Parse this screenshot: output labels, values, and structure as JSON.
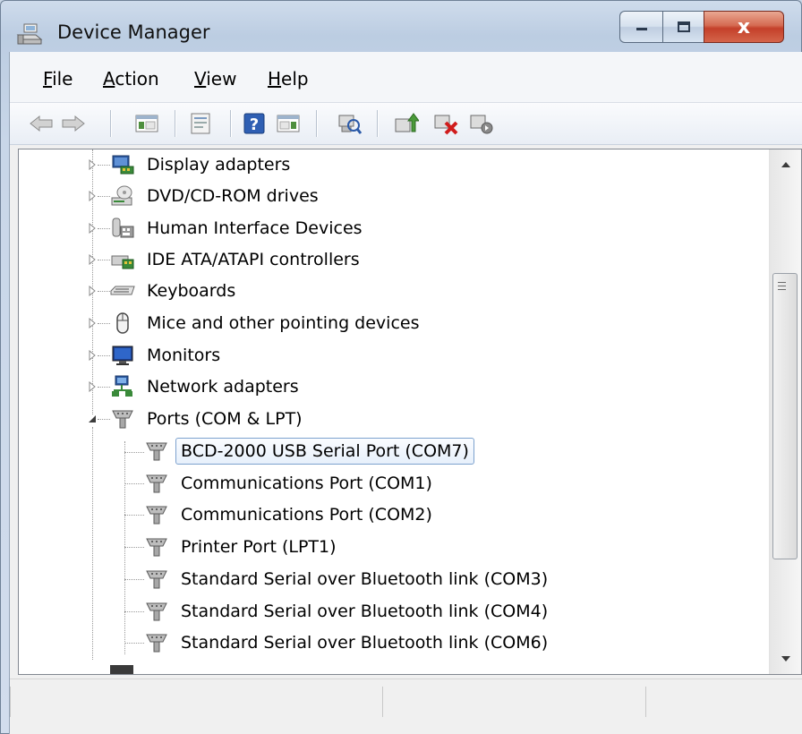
{
  "window": {
    "title": "Device Manager",
    "title_icon": "device-manager-icon",
    "caption": {
      "minimize": "minimize-icon",
      "maximize": "maximize-icon",
      "close_glyph": "x"
    }
  },
  "menu": {
    "items": [
      {
        "label_first": "F",
        "label_rest": "ile"
      },
      {
        "label_first": "A",
        "label_rest": "ction"
      },
      {
        "label_first": "V",
        "label_rest": "iew"
      },
      {
        "label_first": "H",
        "label_rest": "elp"
      }
    ]
  },
  "toolbar": {
    "buttons": [
      "back-icon",
      "forward-icon",
      "show-hide-console-tree-icon",
      "properties-icon",
      "help-icon",
      "show-action-pane-icon",
      "scan-hardware-changes-icon",
      "update-driver-icon",
      "uninstall-icon",
      "disable-icon"
    ]
  },
  "tree": {
    "categories": [
      {
        "label": "Display adapters",
        "icon": "display-adapter-icon",
        "expanded": false
      },
      {
        "label": "DVD/CD-ROM drives",
        "icon": "dvd-drive-icon",
        "expanded": false
      },
      {
        "label": "Human Interface Devices",
        "icon": "hid-icon",
        "expanded": false
      },
      {
        "label": "IDE ATA/ATAPI controllers",
        "icon": "ide-controller-icon",
        "expanded": false
      },
      {
        "label": "Keyboards",
        "icon": "keyboard-icon",
        "expanded": false
      },
      {
        "label": "Mice and other pointing devices",
        "icon": "mouse-icon",
        "expanded": false
      },
      {
        "label": "Monitors",
        "icon": "monitor-icon",
        "expanded": false
      },
      {
        "label": "Network adapters",
        "icon": "network-adapter-icon",
        "expanded": false
      },
      {
        "label": "Ports (COM & LPT)",
        "icon": "port-icon",
        "expanded": true
      }
    ],
    "ports": [
      {
        "label": "BCD-2000 USB Serial Port (COM7)",
        "selected": true
      },
      {
        "label": "Communications Port (COM1)",
        "selected": false
      },
      {
        "label": "Communications Port (COM2)",
        "selected": false
      },
      {
        "label": "Printer Port (LPT1)",
        "selected": false
      },
      {
        "label": "Standard Serial over Bluetooth link (COM3)",
        "selected": false
      },
      {
        "label": "Standard Serial over Bluetooth link (COM4)",
        "selected": false
      },
      {
        "label": "Standard Serial over Bluetooth link (COM6)",
        "selected": false
      }
    ]
  },
  "statusbar": {
    "panes": [
      "",
      "",
      ""
    ]
  }
}
